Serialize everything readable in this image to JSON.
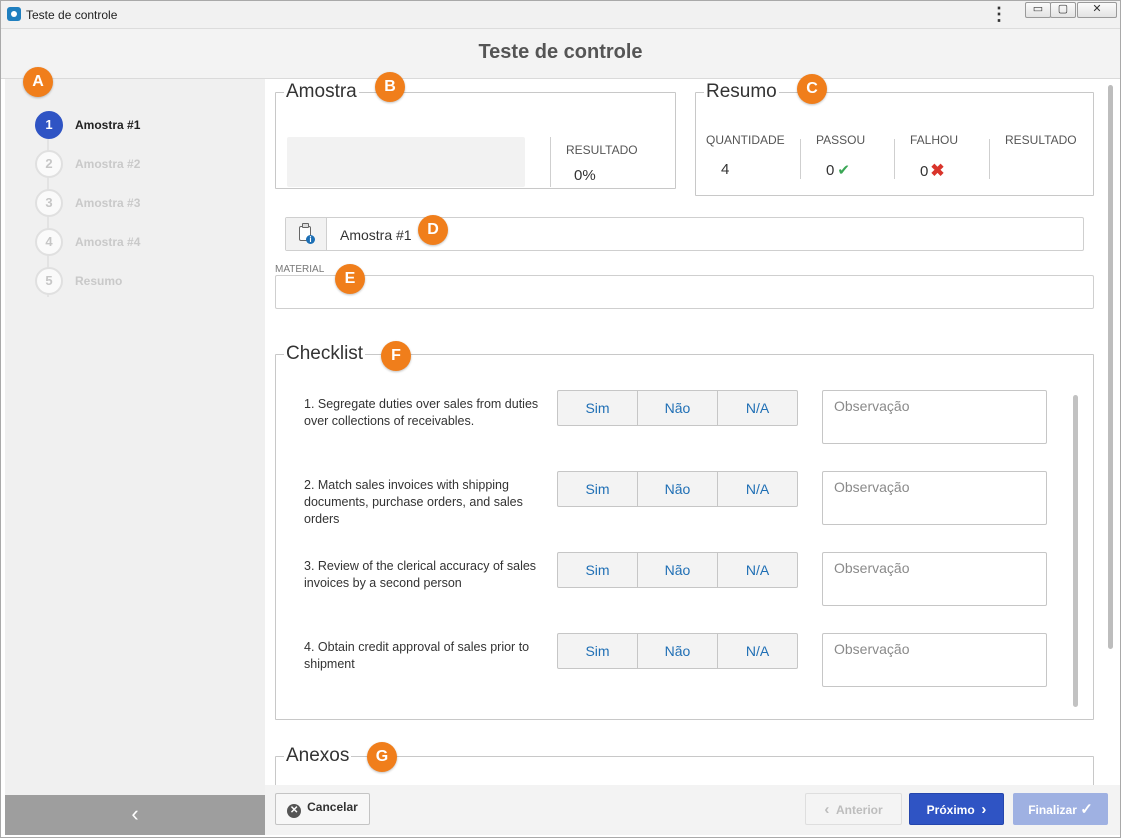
{
  "window": {
    "title": "Teste de controle",
    "controls": {
      "minimize": "▭",
      "maximize": "▢",
      "close": "✕"
    },
    "menu_icon": "⋮"
  },
  "page": {
    "title": "Teste de controle"
  },
  "steps": [
    {
      "number": "1",
      "label": "Amostra #1",
      "active": true
    },
    {
      "number": "2",
      "label": "Amostra #2",
      "active": false
    },
    {
      "number": "3",
      "label": "Amostra #3",
      "active": false
    },
    {
      "number": "4",
      "label": "Amostra #4",
      "active": false
    },
    {
      "number": "5",
      "label": "Resumo",
      "active": false
    }
  ],
  "sidebar": {
    "collapse_icon": "‹"
  },
  "amostra_panel": {
    "title": "Amostra",
    "result_label": "RESULTADO",
    "result_value": "0%"
  },
  "resumo_panel": {
    "title": "Resumo",
    "columns": {
      "quantidade": {
        "label": "QUANTIDADE",
        "value": "4"
      },
      "passou": {
        "label": "PASSOU",
        "value": "0"
      },
      "falhou": {
        "label": "FALHOU",
        "value": "0"
      },
      "resultado": {
        "label": "RESULTADO",
        "value": ""
      }
    },
    "passed_icon": "✔",
    "failed_icon": "✖"
  },
  "amostra_field": {
    "value": "Amostra #1",
    "icon": "clipboard-info-icon"
  },
  "material": {
    "label": "MATERIAL",
    "value": ""
  },
  "checklist": {
    "title": "Checklist",
    "options": {
      "yes": "Sim",
      "no": "Não",
      "na": "N/A"
    },
    "observation_placeholder": "Observação",
    "items": [
      {
        "text": "1. Segregate duties over sales from duties over collections of receivables."
      },
      {
        "text": "2. Match sales invoices with shipping documents, purchase orders, and sales orders"
      },
      {
        "text": "3. Review of the clerical accuracy of sales invoices by a second person"
      },
      {
        "text": "4. Obtain credit approval of sales prior to shipment"
      }
    ]
  },
  "anexos": {
    "title": "Anexos"
  },
  "footer": {
    "cancel": "Cancelar",
    "previous": "Anterior",
    "next": "Próximo",
    "finish": "Finalizar"
  },
  "markers": [
    "A",
    "B",
    "C",
    "D",
    "E",
    "F",
    "G"
  ],
  "colors": {
    "primary": "#2f54c4",
    "marker": "#f07e1b",
    "pass": "#3aa655",
    "fail": "#d9342b"
  }
}
